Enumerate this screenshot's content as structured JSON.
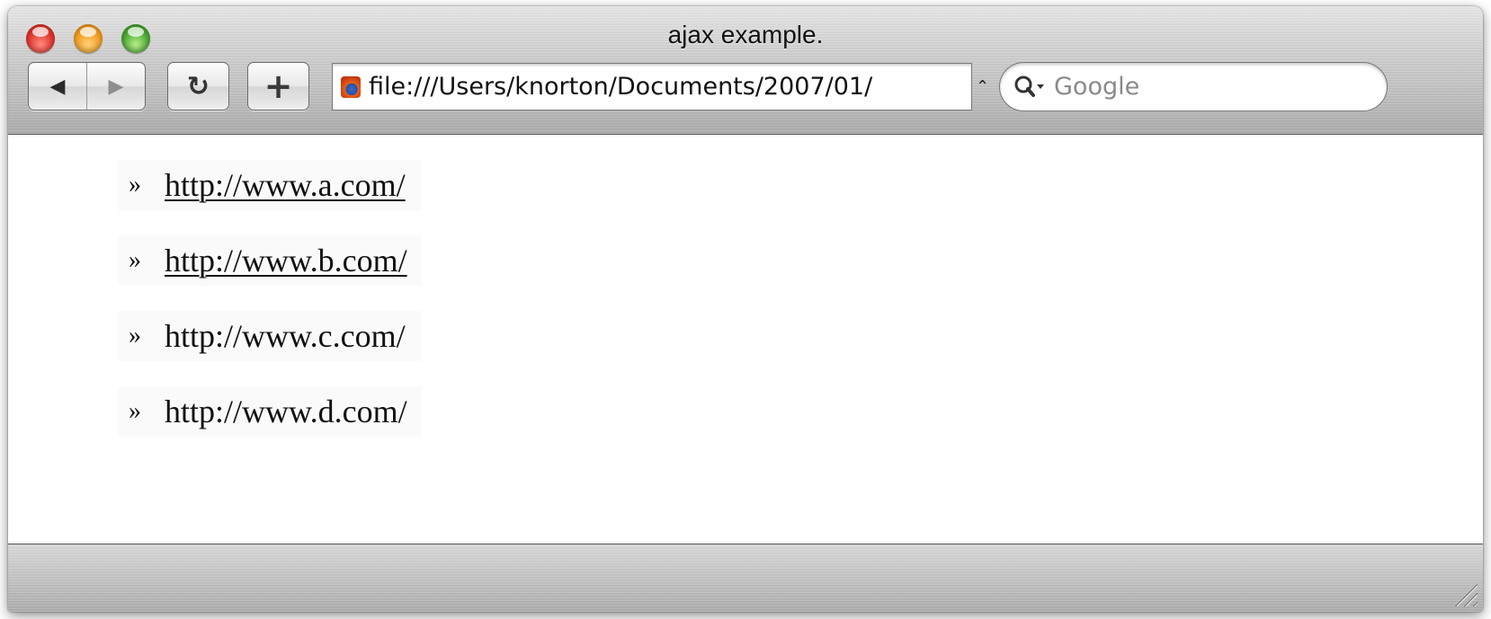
{
  "window": {
    "title": "ajax example."
  },
  "toolbar": {
    "back_icon": "back-arrow-icon",
    "forward_icon": "forward-arrow-icon",
    "reload_glyph": "↻",
    "add_bookmark_glyph": "+",
    "url": "file:///Users/knorton/Documents/2007/01/",
    "search_placeholder": "Google"
  },
  "content": {
    "bullet": "»",
    "items": [
      {
        "text": "http://www.a.com/",
        "is_link": true
      },
      {
        "text": "http://www.b.com/",
        "is_link": true
      },
      {
        "text": "http://www.c.com/",
        "is_link": false
      },
      {
        "text": "http://www.d.com/",
        "is_link": false
      }
    ]
  },
  "colors": {
    "close": "#e0332a",
    "minimize": "#f39c1e",
    "zoom": "#4aa633"
  }
}
